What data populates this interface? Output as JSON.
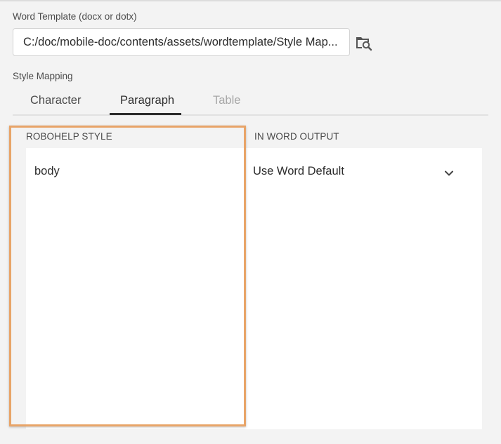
{
  "template_field": {
    "label": "Word Template (docx or dotx)",
    "value": "C:/doc/mobile-doc/contents/assets/wordtemplate/Style Map..."
  },
  "style_mapping": {
    "label": "Style Mapping",
    "tabs": [
      {
        "label": "Character",
        "state": "normal"
      },
      {
        "label": "Paragraph",
        "state": "active"
      },
      {
        "label": "Table",
        "state": "disabled"
      }
    ],
    "columns": {
      "robohelp_style": "ROBOHELP STYLE",
      "word_output": "IN WORD OUTPUT"
    },
    "rows": [
      {
        "style": "body",
        "output": "Use Word Default"
      }
    ]
  },
  "icons": {
    "browse": "folder-search-icon",
    "dropdown": "chevron-down-icon"
  },
  "colors": {
    "highlight": "#e8a468",
    "panel": "#ffffff",
    "background": "#f3f3f3",
    "disabled_text": "#a6a6a6"
  }
}
